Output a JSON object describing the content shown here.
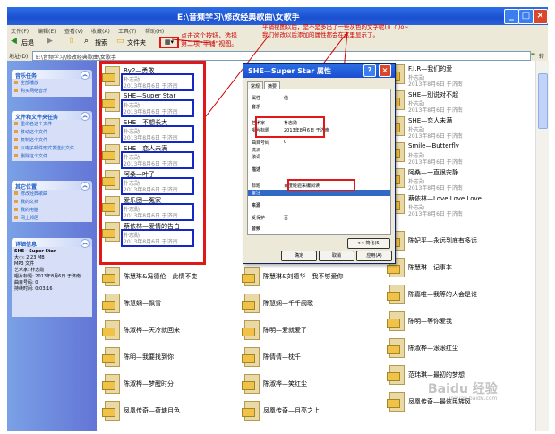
{
  "window": {
    "title": "E:\\音频学习\\修改经典歌曲\\女歌手"
  },
  "menu": [
    "文件(F)",
    "编辑(E)",
    "查看(V)",
    "收藏(A)",
    "工具(T)",
    "帮助(H)"
  ],
  "toolbar": {
    "back": "后退",
    "search": "搜索",
    "folders": "文件夹"
  },
  "address": {
    "label": "地址(D)",
    "value": "E:\\音频学习\\修改经典歌曲\\女歌手",
    "go": "转到"
  },
  "annotations": {
    "left_note": "点击这个按钮，选择\n第二项“平铺”视图。",
    "top_note": "平铺视图以后，是不是多出了一些灰色的文字呢(∩_∩)o~\n我们修改以后添加的属性都会在这里显示了。"
  },
  "left_panels": {
    "music_tasks": {
      "title": "音乐任务",
      "items": [
        "全部播放",
        "购买网络音乐"
      ]
    },
    "file_tasks": {
      "title": "文件和文件夹任务",
      "items": [
        "重命名这个文件",
        "移动这个文件",
        "复制这个文件",
        "以电子邮件形式发送此文件",
        "删除这个文件"
      ]
    },
    "other_places": {
      "title": "其它位置",
      "items": [
        "修改经典歌曲",
        "我的文档",
        "我的电脑",
        "网上邻居"
      ]
    },
    "details": {
      "title": "详细信息",
      "lines": [
        "SHE—Super Star",
        "大小: 2.23 MB",
        "MP3 文件",
        "艺术家: 朴志勋",
        "唱片标题: 2013年8月6日 于济南",
        "曲目号码: 0",
        "持续时间: 0:03:16"
      ]
    }
  },
  "files_left": [
    {
      "name": "By2—勇敢",
      "artist": "朴志勋",
      "album": "2013年8月6日 于济南"
    },
    {
      "name": "SHE—Super Star",
      "artist": "朴志勋",
      "album": "2013年8月6日 于济南"
    },
    {
      "name": "SHE—不想长大",
      "artist": "朴志勋",
      "album": "2013年8月6日 于济南"
    },
    {
      "name": "SHE—恋人未满",
      "artist": "朴志勋",
      "album": "2013年8月6日 于济南"
    },
    {
      "name": "阿桑—叶子",
      "artist": "朴志勋",
      "album": "2013年8月6日 于济南"
    },
    {
      "name": "爱乐团—冤家",
      "artist": "朴志勋",
      "album": "2013年8月6日 于济南"
    },
    {
      "name": "蔡依林—爱情的告白",
      "artist": "朴志勋",
      "album": "2013年8月6日 于济南"
    },
    {
      "name": "陈慧琳&冯德伦—此情不变"
    },
    {
      "name": "陈慧娴—飘雪"
    },
    {
      "name": "陈淑桦—天冷就回来"
    },
    {
      "name": "陈明—我要找到你"
    },
    {
      "name": "陈淑桦—梦醒时分"
    },
    {
      "name": "凤凰传奇—荷塘月色"
    }
  ],
  "files_mid": [
    {
      "name": "陈慧琳&刘德华—我不够爱你"
    },
    {
      "name": "陈慧娴—千千阙歌"
    },
    {
      "name": "陈明—爱就爱了"
    },
    {
      "name": "陈倩倩—枕千"
    },
    {
      "name": "陈淑桦—笑红尘"
    },
    {
      "name": "凤凰传奇—月亮之上"
    }
  ],
  "files_right": [
    {
      "name": "F.I.R—我们的爱",
      "artist": "朴志勋",
      "album": "2013年8月6日 于济南"
    },
    {
      "name": "SHE—别说对不起",
      "artist": "朴志勋",
      "album": "2013年8月6日 于济南"
    },
    {
      "name": "SHE—恋人未满",
      "artist": "朴志勋",
      "album": "2013年8月6日 于济南"
    },
    {
      "name": "Smile—Butterfly",
      "artist": "朴志勋",
      "album": "2013年8月6日 于济南"
    },
    {
      "name": "阿桑—一直很安静",
      "artist": "朴志勋",
      "album": "2013年8月6日 于济南"
    },
    {
      "name": "蔡依林—Love Love Love",
      "artist": "朴志勋",
      "album": "2013年8月6日 于济南"
    },
    {
      "name": "陈妃平—永远到底有多远"
    },
    {
      "name": "陈慧琳—记事本"
    },
    {
      "name": "陈嘉唯—我等的人会是谁"
    },
    {
      "name": "陈明—等你爱我"
    },
    {
      "name": "陈淑桦—滚滚红尘"
    },
    {
      "name": "范玮琪—最初的梦想"
    },
    {
      "name": "凤凰传奇—最炫民族风"
    }
  ],
  "dialog": {
    "title": "SHE—Super Star 属性",
    "tabs": [
      "常规",
      "摘要"
    ],
    "rows": [
      {
        "k": "属性",
        "v": "值"
      },
      {
        "k": "音乐",
        "v": ""
      },
      {
        "k": "艺术家",
        "v": "朴志勋"
      },
      {
        "k": "唱片标题",
        "v": "2013年8月6日 于济南"
      },
      {
        "k": "曲目号码",
        "v": "0"
      },
      {
        "k": "流派",
        "v": ""
      },
      {
        "k": "歌词",
        "v": ""
      },
      {
        "k": "描述",
        "v": ""
      },
      {
        "k": "标题",
        "v": "百度经验采编阅读"
      },
      {
        "k": "备注",
        "v": ""
      },
      {
        "k": "来源",
        "v": ""
      },
      {
        "k": "受保护",
        "v": "否"
      },
      {
        "k": "音频",
        "v": ""
      }
    ],
    "simple_button": "<< 简化(S)",
    "ok": "确定",
    "cancel": "取消",
    "apply": "应用(A)"
  },
  "watermark": "Baidu 经验",
  "watermark_url": "jingyan.baidu.com"
}
